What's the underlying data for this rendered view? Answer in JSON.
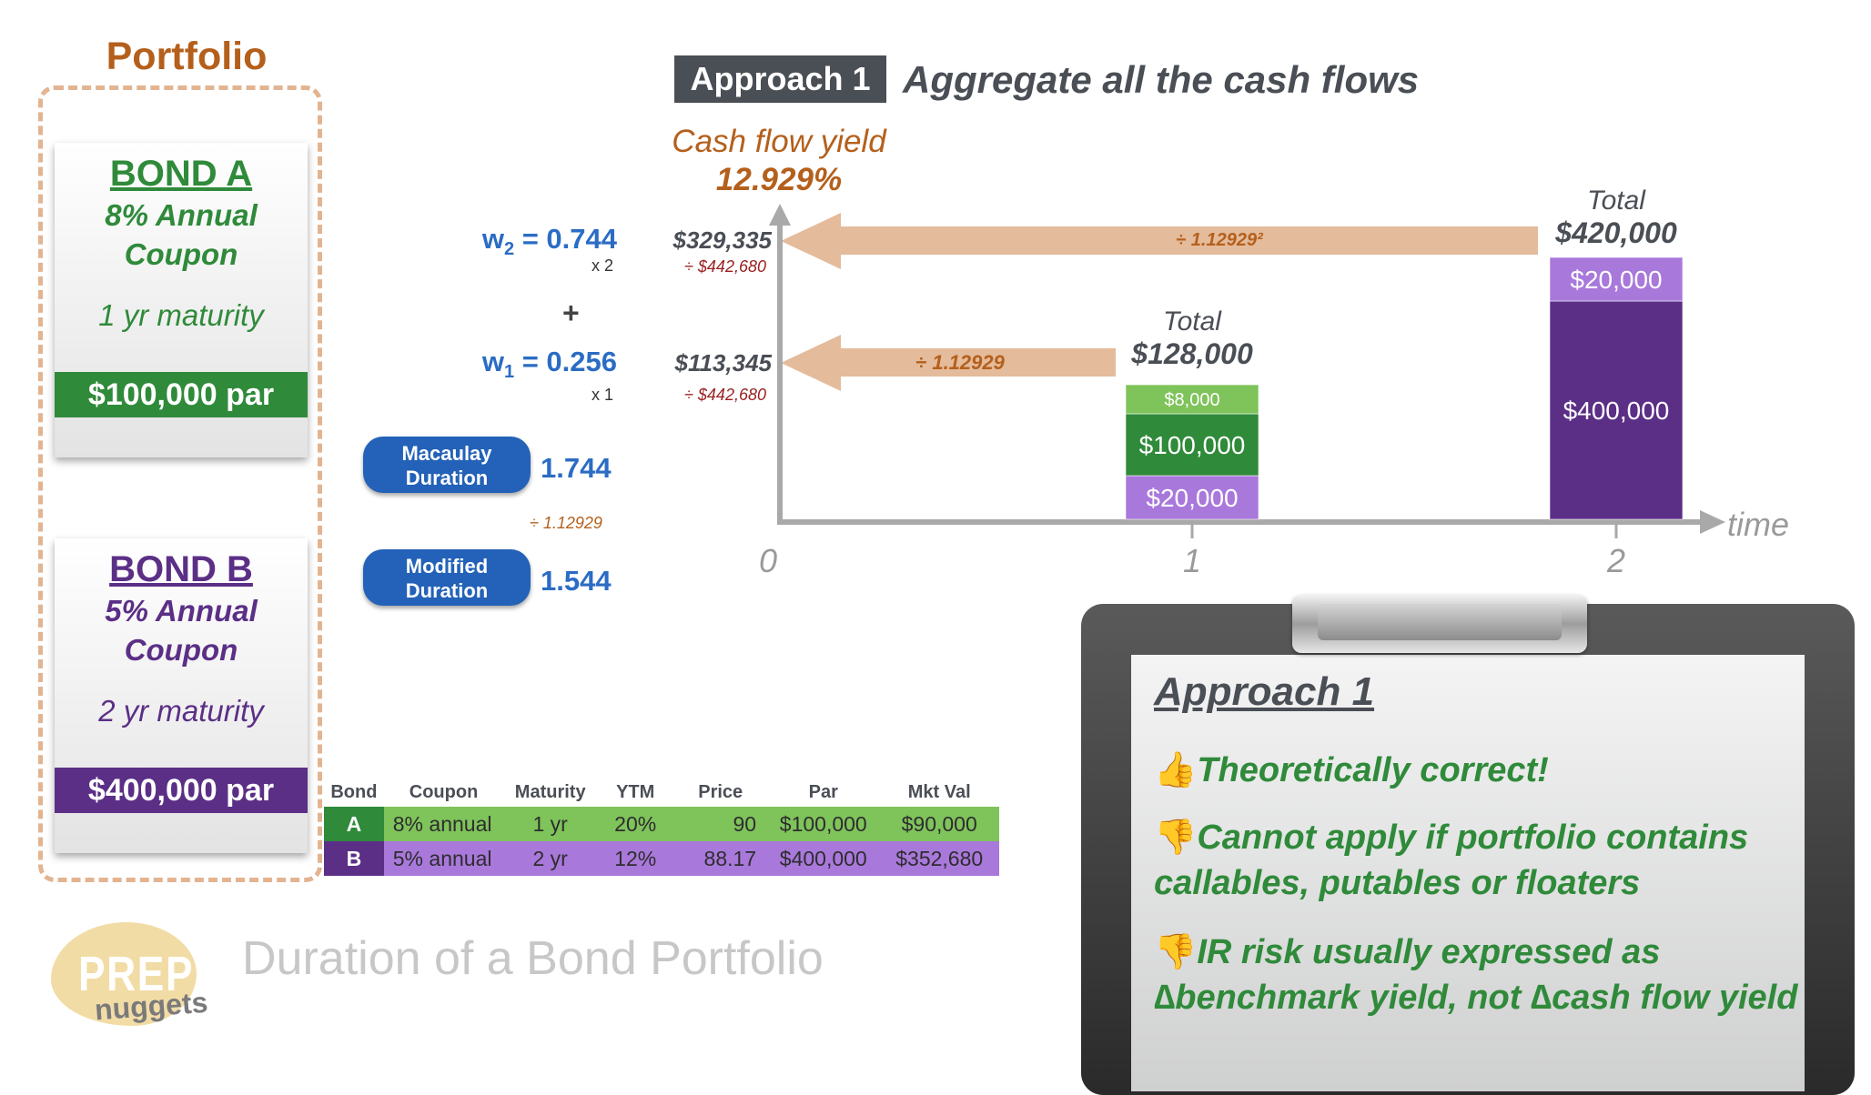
{
  "portfolio": {
    "title": "Portfolio",
    "bond_a": {
      "name": "BOND A",
      "coupon_line1": "8% Annual",
      "coupon_line2": "Coupon",
      "maturity": "1 yr maturity",
      "par": "$100,000 par"
    },
    "bond_b": {
      "name": "BOND B",
      "coupon_line1": "5% Annual",
      "coupon_line2": "Coupon",
      "maturity": "2 yr maturity",
      "par": "$400,000 par"
    }
  },
  "approach": {
    "tag": "Approach 1",
    "heading": "Aggregate all the cash flows"
  },
  "yield": {
    "label": "Cash flow yield",
    "value": "12.929%"
  },
  "weights": {
    "w2_prefix": "w",
    "w2_sub": "2",
    "w2_value": " = 0.744",
    "w2_mult": "x 2",
    "plus": "+",
    "w1_prefix": "w",
    "w1_sub": "1",
    "w1_value": " = 0.256",
    "w1_mult": "x 1"
  },
  "durations": {
    "macaulay_line1": "Macaulay",
    "macaulay_line2": "Duration",
    "macaulay_value": "1.744",
    "divisor": "÷ 1.12929",
    "modified_line1": "Modified",
    "modified_line2": "Duration",
    "modified_value": "1.544"
  },
  "present_values": {
    "pv2": "$329,335",
    "pv2_div": "÷ $442,680",
    "arrow2_label": "÷ 1.12929²",
    "pv1": "$113,345",
    "pv1_div": "÷ $442,680",
    "arrow1_label": "÷ 1.12929"
  },
  "axis": {
    "tick0": "0",
    "tick1": "1",
    "tick2": "2",
    "time_label": "time"
  },
  "colors": {
    "green": "#2f8a3a",
    "light_green": "#7fc35b",
    "purple": "#5b2f86",
    "light_purple": "#a978db",
    "arrow": "#e4bb9b",
    "accent": "#b4601c"
  },
  "chart_data": {
    "type": "bar",
    "categories": [
      "1",
      "2"
    ],
    "x_axis_label": "time",
    "totals_label": "Total",
    "totals": [
      "$128,000",
      "$420,000"
    ],
    "stacks": [
      {
        "t": 1,
        "segments": [
          {
            "label": "$20,000",
            "value": 20000,
            "color": "#a978db"
          },
          {
            "label": "$100,000",
            "value": 100000,
            "color": "#2f8a3a"
          },
          {
            "label": "$8,000",
            "value": 8000,
            "color": "#7fc35b"
          }
        ]
      },
      {
        "t": 2,
        "segments": [
          {
            "label": "$400,000",
            "value": 400000,
            "color": "#5b2f86"
          },
          {
            "label": "$20,000",
            "value": 20000,
            "color": "#a978db"
          }
        ]
      }
    ]
  },
  "table": {
    "headers": [
      "Bond",
      "Coupon",
      "Maturity",
      "YTM",
      "Price",
      "Par",
      "Mkt Val"
    ],
    "rows": [
      [
        "A",
        "8% annual",
        "1 yr",
        "20%",
        "90",
        "$100,000",
        "$90,000"
      ],
      [
        "B",
        "5% annual",
        "2 yr",
        "12%",
        "88.17",
        "$400,000",
        "$352,680"
      ]
    ]
  },
  "clipboard": {
    "title": "Approach 1",
    "items": [
      {
        "icon": "thumbs-up",
        "glyph": "👍",
        "text": "Theoretically correct!"
      },
      {
        "icon": "thumbs-down",
        "glyph": "👎",
        "text": "Cannot apply if portfolio contains callables, putables or floaters"
      },
      {
        "icon": "thumbs-down",
        "glyph": "👎",
        "text": "IR risk usually expressed as ∆benchmark yield, not ∆cash flow yield"
      }
    ]
  },
  "logo": {
    "prep": "PREP",
    "nuggets": "nuggets"
  },
  "footer": "Duration of a Bond Portfolio"
}
